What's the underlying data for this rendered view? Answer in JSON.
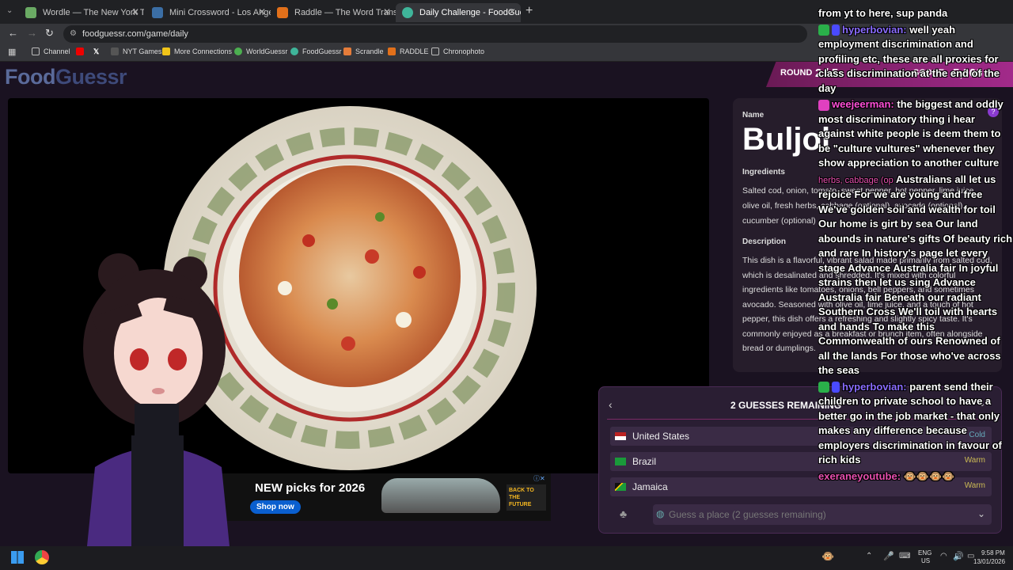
{
  "browser": {
    "tabs": [
      {
        "title": "Wordle — The New York Times",
        "color": "#6aaa64",
        "active": false
      },
      {
        "title": "Mini Crossword - Los Angeles T",
        "color": "#3b6ea5",
        "active": false
      },
      {
        "title": "Raddle — The Word Transforme",
        "color": "#e2701a",
        "active": false
      },
      {
        "title": "Daily Challenge - FoodGuessr |",
        "color": "#3fb59a",
        "active": true
      }
    ],
    "url": "foodguessr.com/game/daily",
    "bookmarks": [
      "Channel",
      "NYT Games",
      "More Connections",
      "WorldGuessr",
      "FoodGuessr",
      "Scrandle",
      "RADDLE",
      "Chronophoto"
    ]
  },
  "app": {
    "logo_food": "Food",
    "logo_guessr": "Guessr",
    "round_label": "ROUND",
    "round_value": "2 / 5",
    "score_label": "SCORE",
    "score_value": "5,000"
  },
  "dish": {
    "name_label": "Name",
    "name": "Buljol",
    "ingredients_label": "Ingredients",
    "ingredients": "Salted cod, onion, tomato, sweet pepper, hot pepper, lime juice, olive oil, fresh herbs, cabbage (optional), avocado (optional), cucumber (optional)",
    "description_label": "Description",
    "description": "This dish is a flavorful, vibrant salad made primarily from salted cod, which is desalinated and shredded. It's mixed with colorful ingredients like tomatoes, onions, bell peppers, and sometimes avocado. Seasoned with olive oil, lime juice, and a touch of hot pepper, this dish offers a refreshing and slightly spicy taste. It's commonly enjoyed as a breakfast or brunch item, often alongside bread or dumplings."
  },
  "guesses": {
    "remaining_label": "2 GUESSES REMAINING",
    "items": [
      {
        "country": "United States",
        "hint": "Cold"
      },
      {
        "country": "Brazil",
        "hint": "Warm"
      },
      {
        "country": "Jamaica",
        "hint": "Warm"
      }
    ],
    "placeholder": "Guess a place (2 guesses remaining)"
  },
  "ad": {
    "headline": "NEW picks for 2026",
    "cta": "Shop now",
    "brand": "BACK TO THE FUTURE"
  },
  "chat": [
    {
      "user": "",
      "text": "from yt to here, sup panda",
      "color": "#ffffff"
    },
    {
      "user": "hyperbovian:",
      "text": "well yeah employment discrimination and profiling etc, these are all proxies for class discrimination at the end of the day",
      "color": "#8a6cff"
    },
    {
      "user": "weejeerman:",
      "text": "the biggest and oddly most discriminatory thing i hear against white people is deem them to be \"culture vultures\" whenever they show appreciation to another culture",
      "color": "#ff4fd8"
    },
    {
      "user": "herbs, cabbage (op",
      "text": "Australians all let us rejoice For we are young and free We've golden soil and wealth for toil Our home is girt by sea Our land abounds in nature's gifts Of beauty rich and rare In history's page let every stage Advance Australia fair In joyful strains then let us sing Advance Australia fair Beneath our radiant Southern Cross We'll toil with hearts and hands To make this Commonwealth of ours Renowned of all the lands For those who've across the seas",
      "color": "#e84fb0"
    },
    {
      "user": "hyperbovian:",
      "text": "parent send their children to private school to have a better go in the job market - that only makes any difference because employers discrimination in favour of rich kids",
      "color": "#8a6cff"
    },
    {
      "user": "exeraneyoutube:",
      "text": "",
      "color": "#e84fb0"
    }
  ],
  "taskbar": {
    "lang": "ENG",
    "region": "US",
    "time": "9:58 PM",
    "date": "13/01/2026"
  }
}
